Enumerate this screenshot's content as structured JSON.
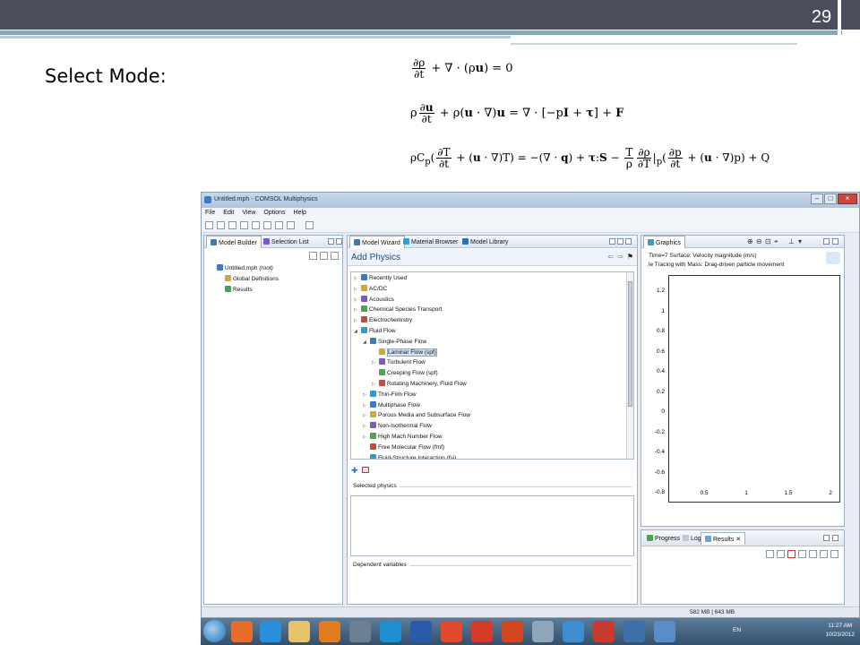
{
  "slide": {
    "number": "29",
    "title": "Select Mode:"
  },
  "equations": {
    "eq1": "∂ρ/∂t + ∇ · (ρu) = 0",
    "eq2": "ρ ∂u/∂t + ρ(u · ∇)u = ∇ · [−pI + τ] + F",
    "eq3": "ρCp(∂T/∂t + (u · ∇)T) = −(∇ · q) + τ:S − (T/ρ)(∂ρ/∂T)|p (∂p/∂t + (u · ∇)p) + Q"
  },
  "window": {
    "title": "Untitled.mph - COMSOL Multiphysics",
    "menu": [
      "File",
      "Edit",
      "View",
      "Options",
      "Help"
    ],
    "controls": [
      "–",
      "□",
      "×"
    ]
  },
  "model_builder": {
    "tabs": [
      "Model Builder",
      "Selection List"
    ],
    "tree": [
      {
        "label": "Untitled.mph",
        "suffix": "(root)"
      },
      {
        "label": "Global Definitions"
      },
      {
        "label": "Results"
      }
    ]
  },
  "wizard": {
    "tabs": [
      "Model Wizard",
      "Material Browser",
      "Model Library"
    ],
    "heading": "Add Physics",
    "physics_tree": [
      {
        "label": "Recently Used",
        "level": 0,
        "arrow": "▷"
      },
      {
        "label": "AC/DC",
        "level": 0,
        "arrow": "▷"
      },
      {
        "label": "Acoustics",
        "level": 0,
        "arrow": "▷"
      },
      {
        "label": "Chemical Species Transport",
        "level": 0,
        "arrow": "▷"
      },
      {
        "label": "Electrochemistry",
        "level": 0,
        "arrow": "▷"
      },
      {
        "label": "Fluid Flow",
        "level": 0,
        "arrow": "◢"
      },
      {
        "label": "Single-Phase Flow",
        "level": 1,
        "arrow": "◢"
      },
      {
        "label": "Laminar Flow (spf)",
        "level": 2,
        "arrow": "",
        "selected": true
      },
      {
        "label": "Turbulent Flow",
        "level": 2,
        "arrow": "▷"
      },
      {
        "label": "Creeping Flow (spf)",
        "level": 2,
        "arrow": ""
      },
      {
        "label": "Rotating Machinery, Fluid Flow",
        "level": 2,
        "arrow": "▷"
      },
      {
        "label": "Thin-Film Flow",
        "level": 1,
        "arrow": "▷"
      },
      {
        "label": "Multiphase Flow",
        "level": 1,
        "arrow": "▷"
      },
      {
        "label": "Porous Media and Subsurface Flow",
        "level": 1,
        "arrow": "▷"
      },
      {
        "label": "Non-Isothermal Flow",
        "level": 1,
        "arrow": "▷"
      },
      {
        "label": "High Mach Number Flow",
        "level": 1,
        "arrow": "▷"
      },
      {
        "label": "Free Molecular Flow (fmf)",
        "level": 1,
        "arrow": ""
      },
      {
        "label": "Fluid-Structure Interaction (fsi)",
        "level": 1,
        "arrow": ""
      }
    ],
    "selected_physics_label": "Selected physics",
    "dependent_variables_label": "Dependent variables"
  },
  "graphics": {
    "tab": "Graphics",
    "line1": "Time=7  Surface: Velocity magnitude (m/s)",
    "line2": "le Tracing with Mass: Drag-driven particle movement",
    "yticks": [
      "1.2",
      "1",
      "0.8",
      "0.6",
      "0.4",
      "0.2",
      "0",
      "-0.2",
      "-0.4",
      "-0.6",
      "-0.8"
    ],
    "xticks": [
      "0.5",
      "1",
      "1.5",
      "2"
    ]
  },
  "bottom_panel": {
    "tabs": [
      "Progress",
      "Log",
      "Results"
    ]
  },
  "status": {
    "memory": "582 MB | 643 MB"
  },
  "taskbar": {
    "lang": "EN",
    "time": "11:27 AM",
    "date": "10/23/2012"
  }
}
